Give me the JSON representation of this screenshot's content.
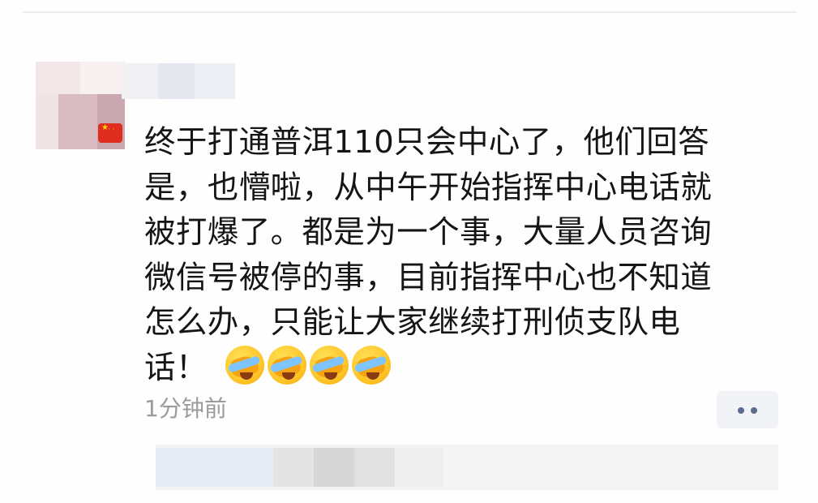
{
  "post": {
    "lines": [
      "终于打通普洱110只会中心了，他们回答",
      "是，也懵啦，从中午开始指挥中心电话就",
      "被打爆了。都是为一个事，大量人员咨询",
      "微信号被停的事，目前指挥中心也不知道",
      "怎么办，只能让大家继续打刑侦支队电",
      "话！"
    ],
    "emoji_count": 4,
    "emoji_icon": "face-with-tears-covering-eyes-icon"
  },
  "meta": {
    "time_text": "1分钟前"
  },
  "colors": {
    "text": "#151515",
    "timestamp": "#9b9b9b",
    "more_button_bg": "#f1f3f6",
    "more_button_dots": "#5a6d8f"
  }
}
